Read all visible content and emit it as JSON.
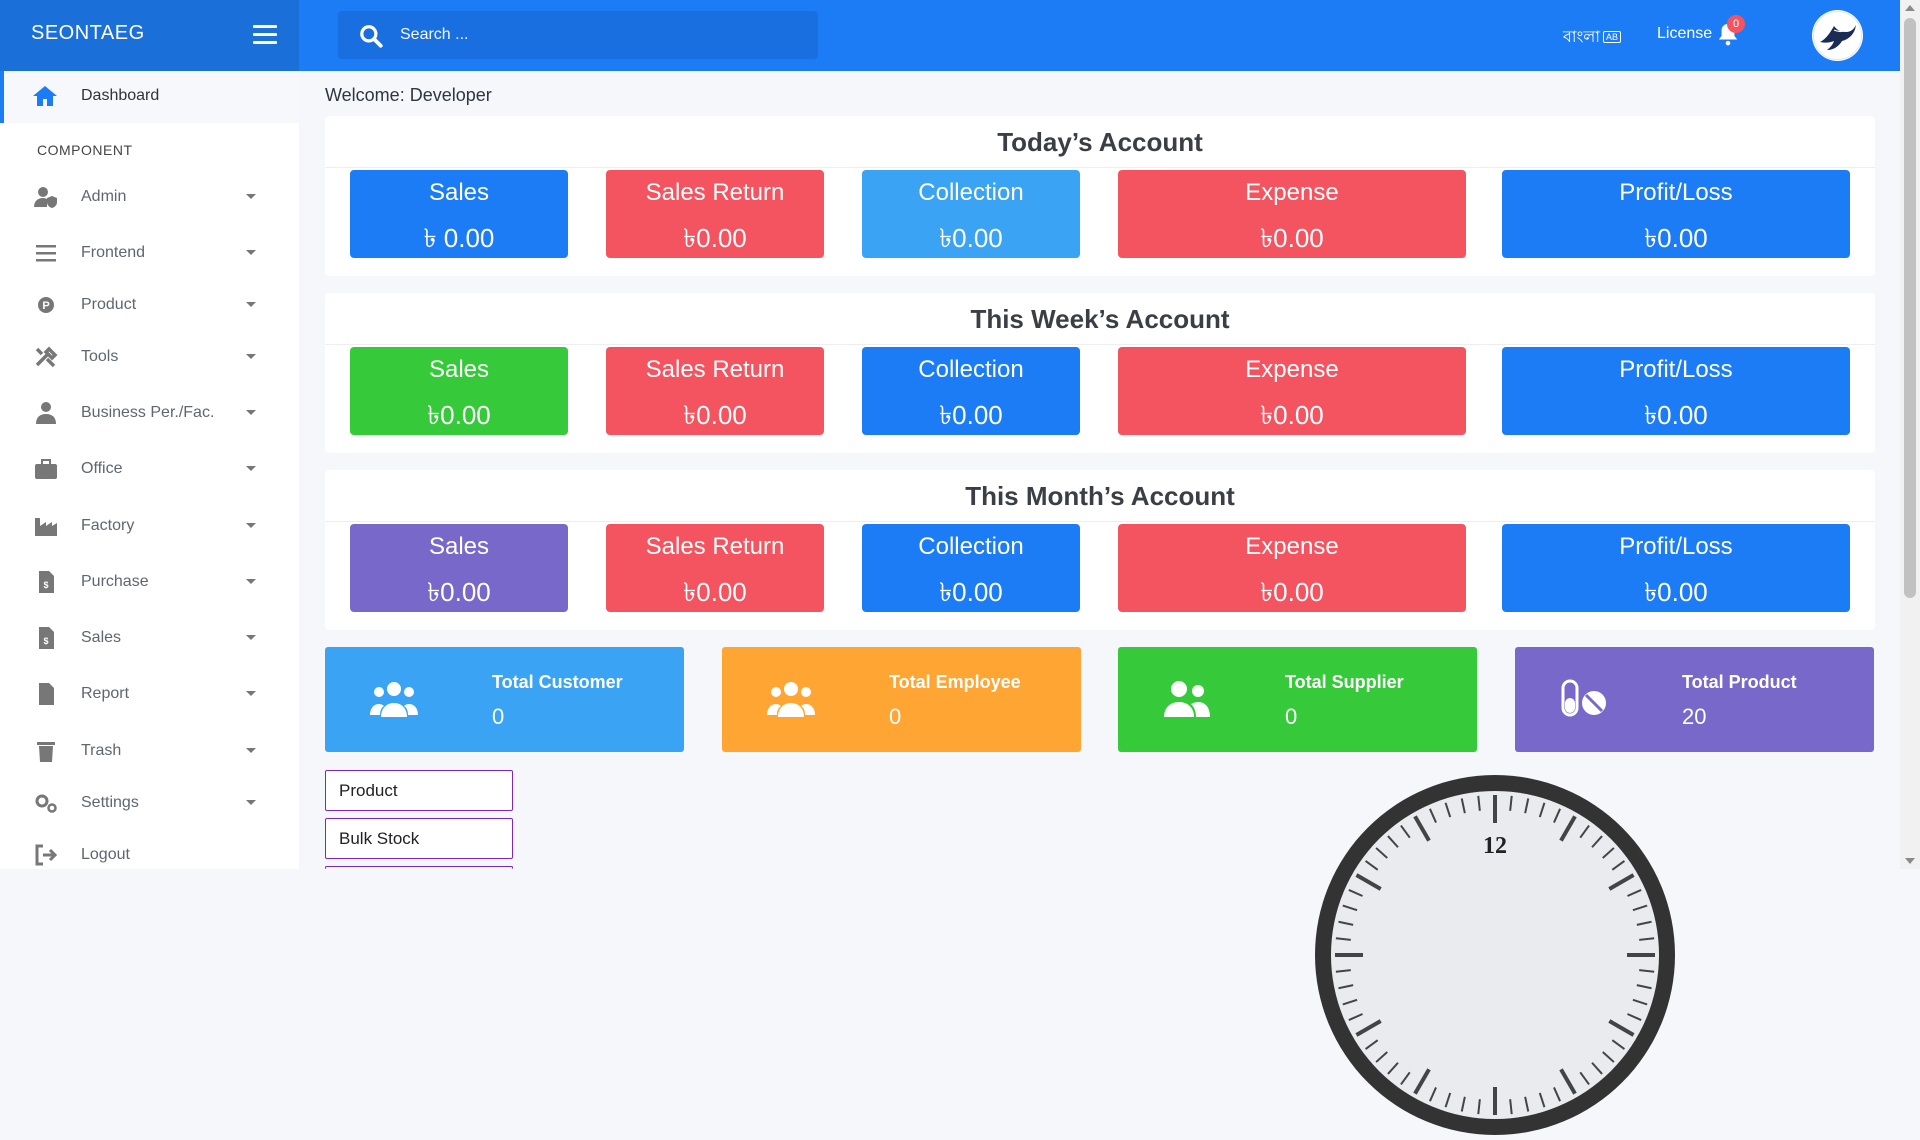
{
  "app": {
    "brand": "SEONTAEG"
  },
  "search": {
    "placeholder": "Search ..."
  },
  "header": {
    "language": "বাংলা",
    "language_badge": "AB",
    "license": "License",
    "notification_count": "0"
  },
  "sidebar": {
    "dashboard": "Dashboard",
    "section": "COMPONENT",
    "items": [
      {
        "label": "Admin",
        "icon": "user-shield-icon"
      },
      {
        "label": "Frontend",
        "icon": "bars-icon"
      },
      {
        "label": "Product",
        "icon": "product-p-icon"
      },
      {
        "label": "Tools",
        "icon": "tools-icon"
      },
      {
        "label": "Business Per./Fac.",
        "icon": "user-tie-icon"
      },
      {
        "label": "Office",
        "icon": "briefcase-icon"
      },
      {
        "label": "Factory",
        "icon": "industry-icon"
      },
      {
        "label": "Purchase",
        "icon": "invoice-dollar-icon"
      },
      {
        "label": "Sales",
        "icon": "invoice-dollar-icon"
      },
      {
        "label": "Report",
        "icon": "file-icon"
      },
      {
        "label": "Trash",
        "icon": "trash-icon"
      },
      {
        "label": "Settings",
        "icon": "cogs-icon"
      },
      {
        "label": "Logout",
        "icon": "sign-out-icon"
      }
    ]
  },
  "welcome": "Welcome: Developer",
  "accounts": [
    {
      "title": "Today’s Account",
      "cards": [
        {
          "label": "Sales",
          "value": "৳ 0.00",
          "color": "#1c7cf5"
        },
        {
          "label": "Sales Return",
          "value": "৳0.00",
          "color": "#f4545f"
        },
        {
          "label": "Collection",
          "value": "৳0.00",
          "color": "#3aa3f3"
        },
        {
          "label": "Expense",
          "value": "৳0.00",
          "color": "#f4545f"
        },
        {
          "label": "Profit/Loss",
          "value": "৳0.00",
          "color": "#1c7cf5"
        }
      ]
    },
    {
      "title": "This Week’s Account",
      "cards": [
        {
          "label": "Sales",
          "value": "৳0.00",
          "color": "#36ca3a"
        },
        {
          "label": "Sales Return",
          "value": "৳0.00",
          "color": "#f4545f"
        },
        {
          "label": "Collection",
          "value": "৳0.00",
          "color": "#1c7cf5"
        },
        {
          "label": "Expense",
          "value": "৳0.00",
          "color": "#f4545f"
        },
        {
          "label": "Profit/Loss",
          "value": "৳0.00",
          "color": "#1c7cf5"
        }
      ]
    },
    {
      "title": "This Month’s Account",
      "cards": [
        {
          "label": "Sales",
          "value": "৳0.00",
          "color": "#7868c9"
        },
        {
          "label": "Sales Return",
          "value": "৳0.00",
          "color": "#f4545f"
        },
        {
          "label": "Collection",
          "value": "৳0.00",
          "color": "#1c7cf5"
        },
        {
          "label": "Expense",
          "value": "৳0.00",
          "color": "#f4545f"
        },
        {
          "label": "Profit/Loss",
          "value": "৳0.00",
          "color": "#1c7cf5"
        }
      ]
    }
  ],
  "stats": [
    {
      "label": "Total Customer",
      "value": "0",
      "color": "#3aa3f3",
      "icon": "users-icon"
    },
    {
      "label": "Total Employee",
      "value": "0",
      "color": "#ffa533",
      "icon": "users-icon"
    },
    {
      "label": "Total Supplier",
      "value": "0",
      "color": "#36ca3a",
      "icon": "user-friends-icon"
    },
    {
      "label": "Total Product",
      "value": "20",
      "color": "#7868c9",
      "icon": "pills-icon"
    }
  ],
  "quick_links": [
    "Product",
    "Bulk Stock"
  ],
  "clock": {
    "numeral": "12"
  }
}
